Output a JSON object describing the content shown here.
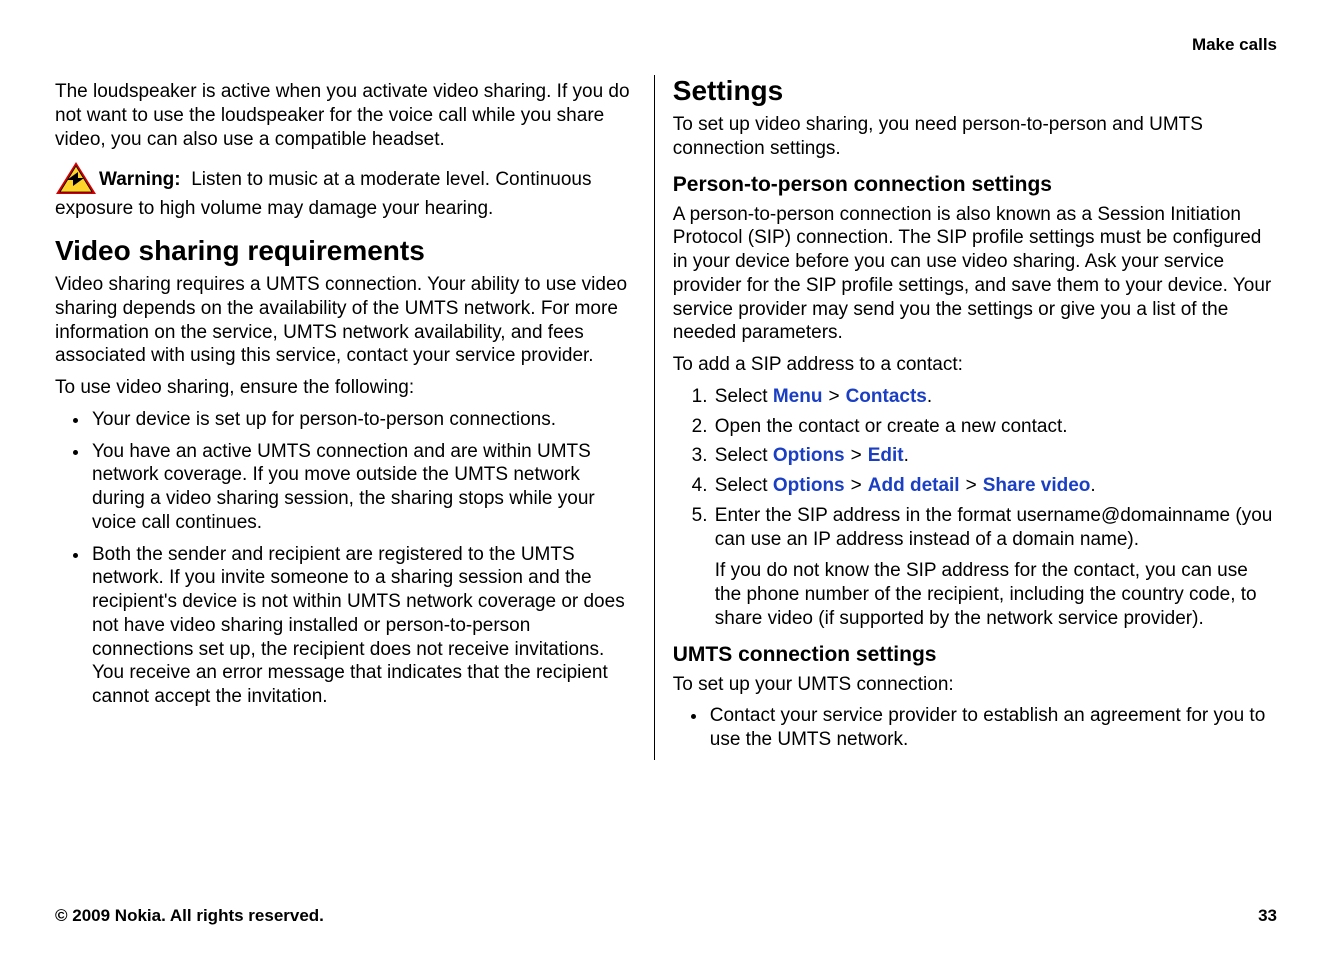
{
  "header": {
    "section": "Make calls"
  },
  "left": {
    "intro": "The loudspeaker is active when you activate video sharing. If you do not want to use the loudspeaker for the voice call while you share video, you can also use a compatible headset.",
    "warning_label": "Warning:",
    "warning_text": "Listen to music at a moderate level. Continuous exposure to high volume may damage your hearing.",
    "h2": "Video sharing requirements",
    "req_p1": "Video sharing requires a UMTS connection. Your ability to use video sharing depends on the availability of the UMTS network. For more information on the service, UMTS network availability, and fees associated with using this service, contact your service provider.",
    "req_p2": "To use video sharing, ensure the following:",
    "bullets": [
      "Your device is set up for person-to-person connections.",
      "You have an active UMTS connection and are within UMTS network coverage. If you move outside the UMTS network during a video sharing session, the sharing stops while your voice call continues.",
      "Both the sender and recipient are registered to the UMTS network. If you invite someone to a sharing session and the recipient's device is not within UMTS network coverage or does not have video sharing installed or person-to-person connections set up, the recipient does not receive invitations. You receive an error message that indicates that the recipient cannot accept the invitation."
    ]
  },
  "right": {
    "h2": "Settings",
    "p1": "To set up video sharing, you need person-to-person and UMTS connection settings.",
    "h3a": "Person-to-person connection settings",
    "p2": "A person-to-person connection is also known as a Session Initiation Protocol (SIP) connection. The SIP profile settings must be configured in your device before you can use video sharing. Ask your service provider for the SIP profile settings, and save them to your device. Your service provider may send you the settings or give you a list of the needed parameters.",
    "p3": "To add a SIP address to a contact:",
    "step1_prefix": "Select ",
    "step1_menu": "Menu",
    "step1_contacts": "Contacts",
    "step2": "Open the contact or create a new contact.",
    "step3_prefix": "Select ",
    "step3_options": "Options",
    "step3_edit": "Edit",
    "step4_prefix": "Select ",
    "step4_options": "Options",
    "step4_add": "Add detail",
    "step4_share": "Share video",
    "step5": "Enter the SIP address in the format username@domainname (you can use an IP address instead of a domain name).",
    "step5_note": "If you do not know the SIP address for the contact, you can use the phone number of the recipient, including the country code, to share video (if supported by the network service provider).",
    "h3b": "UMTS connection settings",
    "p4": "To set up your UMTS connection:",
    "umts_bullet": "Contact your service provider to establish an agreement for you to use the UMTS network."
  },
  "footer": {
    "copyright": "© 2009 Nokia. All rights reserved.",
    "page": "33"
  },
  "sep": ">"
}
